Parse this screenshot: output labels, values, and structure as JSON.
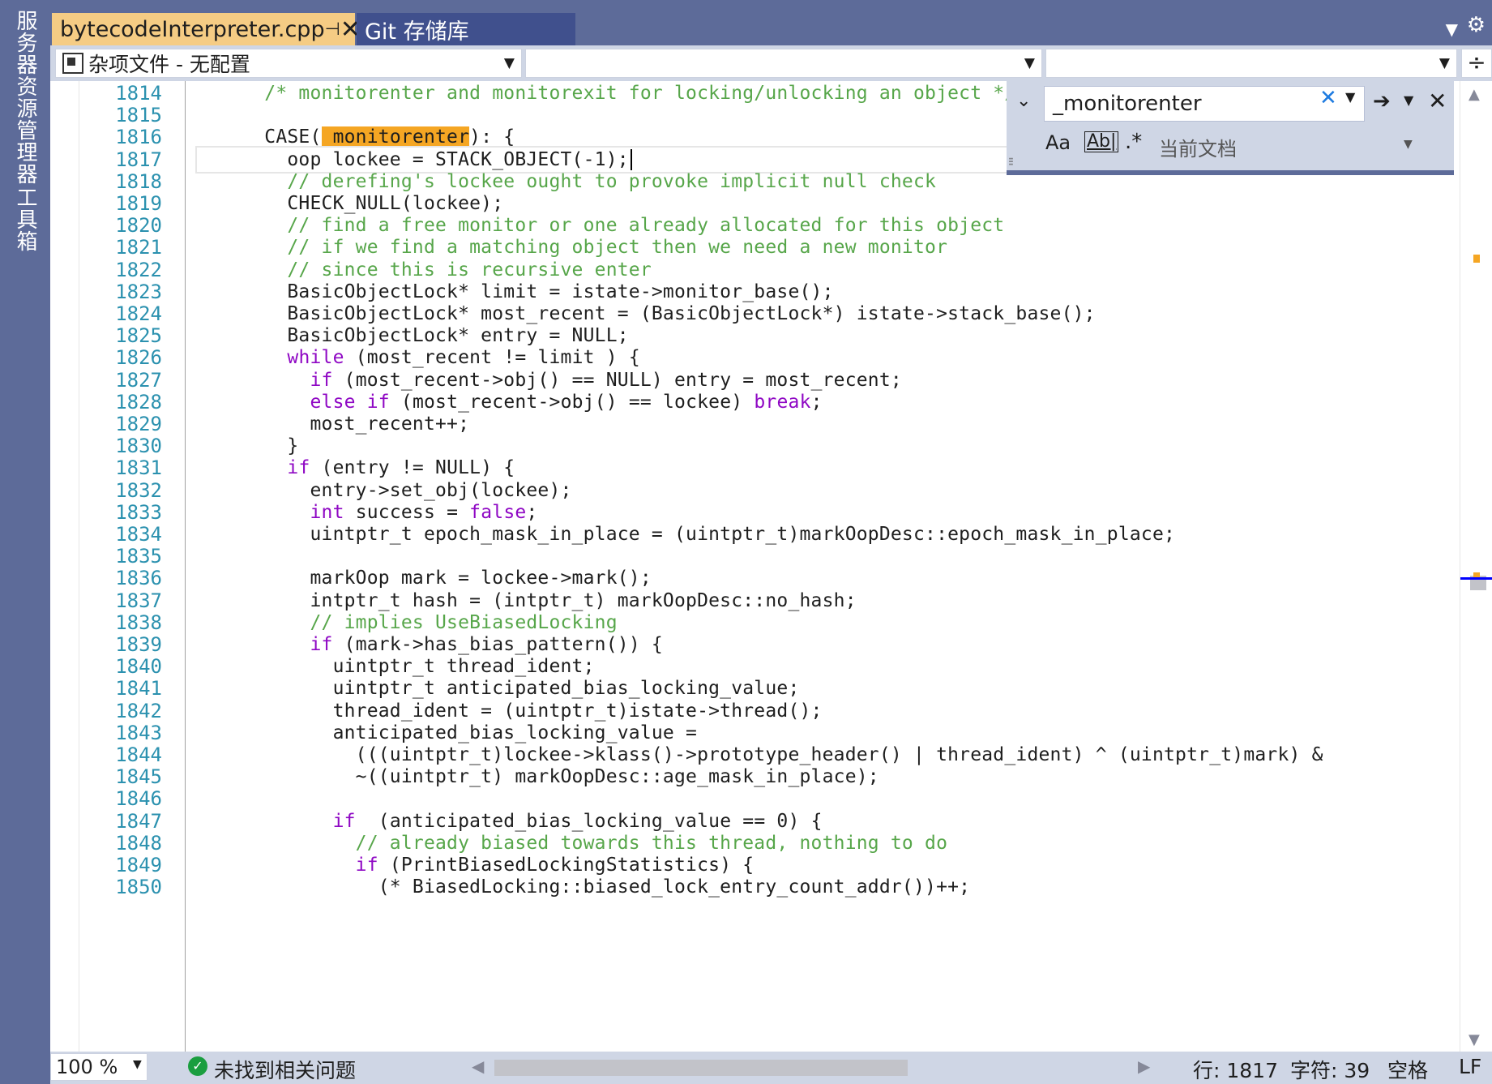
{
  "side_panels": {
    "server_explorer": "服务器资源管理器",
    "toolbox": "工具箱"
  },
  "tabs": {
    "active": "bytecodeInterpreter.cpp",
    "active_pin": "⊕",
    "active_close": "✕",
    "second": "Git 存储库"
  },
  "navbar": {
    "project": "杂项文件 - 无配置",
    "scope": "",
    "member": ""
  },
  "find": {
    "query": "_monitorenter",
    "scope": "当前文档",
    "option_case": "Aa",
    "option_word": "Ab|",
    "option_regex": ".*"
  },
  "editor": {
    "line_numbers": [
      "1814",
      "1815",
      "1816",
      "1817",
      "1818",
      "1819",
      "1820",
      "1821",
      "1822",
      "1823",
      "1824",
      "1825",
      "1826",
      "1827",
      "1828",
      "1829",
      "1830",
      "1831",
      "1832",
      "1833",
      "1834",
      "1835",
      "1836",
      "1837",
      "1838",
      "1839",
      "1840",
      "1841",
      "1842",
      "1843",
      "1844",
      "1845",
      "1846",
      "1847",
      "1848",
      "1849",
      "1850"
    ],
    "lines": [
      "      /* monitorenter and monitorexit for locking/unlocking an object */",
      "",
      "      CASE(_monitorenter): {",
      "        oop lockee = STACK_OBJECT(-1);",
      "        // derefing's lockee ought to provoke implicit null check",
      "        CHECK_NULL(lockee);",
      "        // find a free monitor or one already allocated for this object",
      "        // if we find a matching object then we need a new monitor",
      "        // since this is recursive enter",
      "        BasicObjectLock* limit = istate->monitor_base();",
      "        BasicObjectLock* most_recent = (BasicObjectLock*) istate->stack_base();",
      "        BasicObjectLock* entry = NULL;",
      "        while (most_recent != limit ) {",
      "          if (most_recent->obj() == NULL) entry = most_recent;",
      "          else if (most_recent->obj() == lockee) break;",
      "          most_recent++;",
      "        }",
      "        if (entry != NULL) {",
      "          entry->set_obj(lockee);",
      "          int success = false;",
      "          uintptr_t epoch_mask_in_place = (uintptr_t)markOopDesc::epoch_mask_in_place;",
      "",
      "          markOop mark = lockee->mark();",
      "          intptr_t hash = (intptr_t) markOopDesc::no_hash;",
      "          // implies UseBiasedLocking",
      "          if (mark->has_bias_pattern()) {",
      "            uintptr_t thread_ident;",
      "            uintptr_t anticipated_bias_locking_value;",
      "            thread_ident = (uintptr_t)istate->thread();",
      "            anticipated_bias_locking_value =",
      "              (((uintptr_t)lockee->klass()->prototype_header() | thread_ident) ^ (uintptr_t)mark) &",
      "              ~((uintptr_t) markOopDesc::age_mask_in_place);",
      "",
      "            if  (anticipated_bias_locking_value == 0) {",
      "              // already biased towards this thread, nothing to do",
      "              if (PrintBiasedLockingStatistics) {",
      "                (* BiasedLocking::biased_lock_entry_count_addr())++;"
    ]
  },
  "status": {
    "zoom": "100 %",
    "issues": "未找到相关问题",
    "line": "行: 1817",
    "col": "字符: 39",
    "indent": "空格",
    "eol": "LF"
  },
  "colors": {
    "chrome": "#5d6b99",
    "keyword": "#8f08c4",
    "comment": "#57a64a",
    "line_number": "#2b91af",
    "highlight": "#f5a623"
  }
}
